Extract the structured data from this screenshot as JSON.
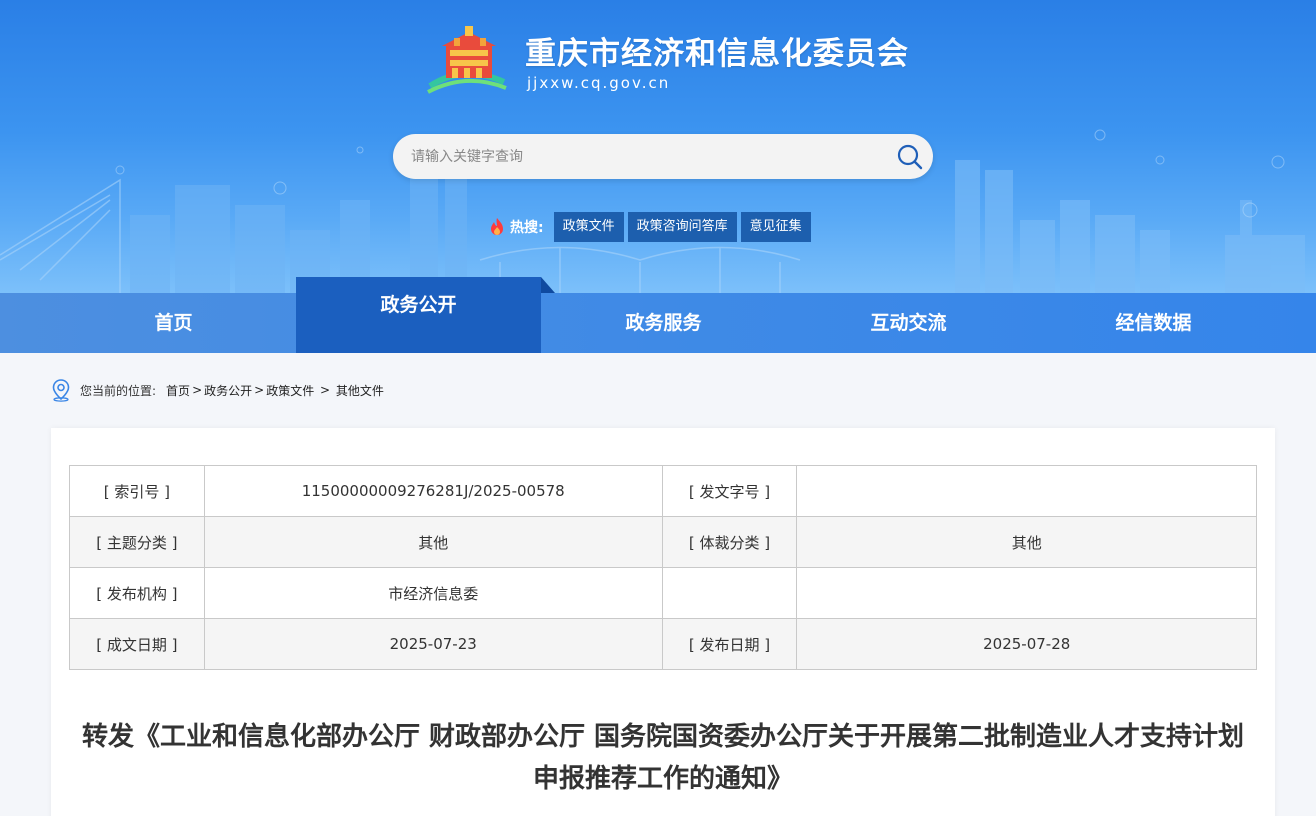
{
  "site": {
    "name": "重庆市经济和信息化委员会",
    "domain": "jjxxw.cq.gov.cn"
  },
  "search": {
    "placeholder": "请输入关键字查询",
    "value": ""
  },
  "hot": {
    "label": "热搜:",
    "tags": [
      "政策文件",
      "政策咨询问答库",
      "意见征集"
    ]
  },
  "nav": {
    "items": [
      "首页",
      "政务公开",
      "政务服务",
      "互动交流",
      "经信数据"
    ],
    "active": "政务公开"
  },
  "breadcrumb": {
    "prefix": "您当前的位置:",
    "items": [
      "首页",
      "政务公开",
      "政策文件",
      "其他文件"
    ],
    "seps": [
      ">",
      ">",
      " > "
    ]
  },
  "meta": {
    "rows": [
      {
        "k1": "[ 索引号 ]",
        "v1": "11500000009276281J/2025-00578",
        "k2": "[ 发文字号 ]",
        "v2": ""
      },
      {
        "k1": "[ 主题分类 ]",
        "v1": "其他",
        "k2": "[ 体裁分类 ]",
        "v2": "其他"
      },
      {
        "k1": "[ 发布机构 ]",
        "v1": "市经济信息委",
        "k2": "",
        "v2": ""
      },
      {
        "k1": "[ 成文日期 ]",
        "v1": "2025-07-23",
        "k2": "[ 发布日期 ]",
        "v2": "2025-07-28"
      }
    ]
  },
  "document": {
    "title": "转发《工业和信息化部办公厅 财政部办公厅 国务院国资委办公厅关于开展第二批制造业人才支持计划申报推荐工作的通知》"
  },
  "colors": {
    "header_top": "#2a7fe6",
    "nav_active": "#1b5fbf",
    "hot_tag_bg": "#1d5fae"
  }
}
